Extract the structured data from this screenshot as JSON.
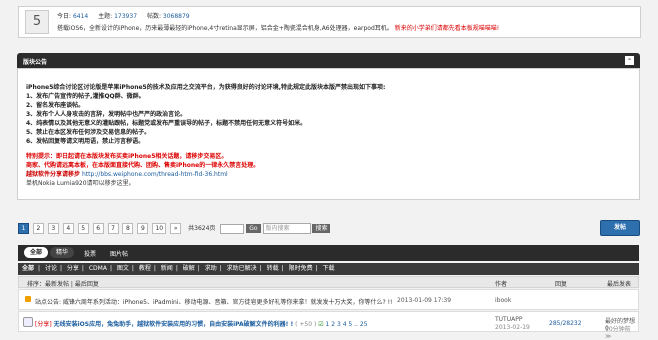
{
  "forum": {
    "today_label": "今日:",
    "today_value": "6414",
    "topics_label": "主题:",
    "topics_value": "173937",
    "posts_label": "帖数:",
    "posts_value": "3068879",
    "icon_char": "5",
    "desc": "搭载iOS6，全新设计的iPhone，历来最薄最轻的iPhone,4寸retina显示屏，铝合金+陶瓷混合机身,A6处理器，earpod耳机。",
    "desc_red": "新来的小学弟们请都先看本板规喵喵喵!"
  },
  "announce": {
    "title": "版块公告",
    "intro": "iPhone5综合讨论区讨论版是苹果iPhone5的技术及应用之交流平台，为获得良好的讨论环境,特此规定此版块本版严禁出现如下事项:",
    "rules": [
      "1、发布广告宣传的帖子,灌推QQ群、微群。",
      "2、留名发布座谈帖。",
      "3、发布个人人身攻击的言辞，发明帖中也严严的政治言论。",
      "4、纯表情以及其他无意义的灌贴跟帖，标题党或发布严重误导的帖子，标题不禁用任何无意义符号如米。",
      "5、禁止在本区发布任何涉及交易信息的帖子。",
      "6、发帖回复等请文明用语，禁止污言秽语。"
    ],
    "warn1": "特别提示：即日起请在本版块发布买卖iPhone5相关话题，请移步交易区。",
    "warn2": "商家、代购请远离本板，在本版面直接代购、团购、售卖iPhone的一律永久禁言处理。",
    "link_label": "越狱软件分享请移步",
    "link_url": "http://bbs.weiphone.com/thread-htm-fid-36.html",
    "footer": "单机Nokia Lumia920请叩以移步这里。"
  },
  "pager": {
    "pages": [
      "1",
      "2",
      "3",
      "4",
      "5",
      "6",
      "7",
      "8",
      "9",
      "10"
    ],
    "next": "»",
    "total": "共3624页",
    "go": "Go",
    "search_placeholder": "版内搜索",
    "search_btn": "搜索"
  },
  "post_button": "发帖",
  "tabs": [
    {
      "label": "全部"
    },
    {
      "label": "精华"
    },
    {
      "label": "投票"
    },
    {
      "label": "图片帖"
    }
  ],
  "categories": [
    "全部",
    "讨论",
    "分享",
    "CDMA",
    "图文",
    "教程",
    "新闻",
    "破解",
    "求助",
    "求助已解决",
    "转载",
    "限时免费",
    "下载"
  ],
  "list": {
    "sort_label": "排序：最新发帖 | 最后回复",
    "col_author": "作者",
    "col_replies": "回复",
    "col_last": "最后发表"
  },
  "rows": [
    {
      "title": "站点公告: 威锋六周年系列活动：iPhone5、iPadmini、移动电源、音箱、官方徒皂更多好礼等你来拿！就发发十万大奖，你等什么? !!",
      "date": "2013-01-09 17:39",
      "author": "ibook",
      "replies": "",
      "last": ""
    },
    {
      "tag": "[分享]",
      "title": "无线安装iOS应用，兔兔助手，越狱软件安装应用的习惯，自由安装iPA破解文件的利器! !",
      "meta": "( +50 )",
      "pages": "1 2 3 4 5 .. 25",
      "author": "TUTUAPP",
      "date2": "2013-02-19",
      "replies": "285/28232",
      "last": "最好的梦想0",
      "last_sub": "10分钟前 ≫"
    }
  ]
}
